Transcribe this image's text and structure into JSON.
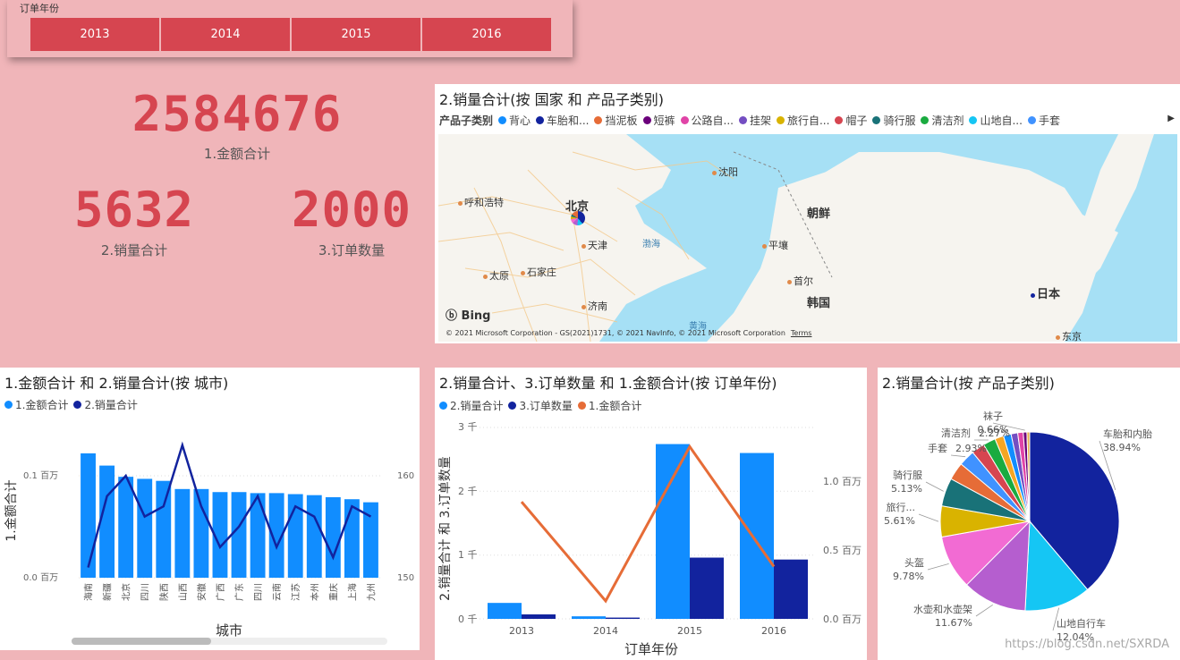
{
  "slicer": {
    "title": "订单年份",
    "years": [
      "2013",
      "2014",
      "2015",
      "2016"
    ]
  },
  "cards": {
    "amount": {
      "value": "2584676",
      "label": "1.金额合计"
    },
    "sales": {
      "value": "5632",
      "label": "2.销量合计"
    },
    "orders": {
      "value": "2000",
      "label": "3.订单数量"
    }
  },
  "map_panel": {
    "title": "2.销量合计(按 国家 和 产品子类别)",
    "legend_title": "产品子类别",
    "legend_items": [
      {
        "label": "背心",
        "color": "#118dff"
      },
      {
        "label": "车胎和...",
        "color": "#12239e"
      },
      {
        "label": "挡泥板",
        "color": "#e66c37"
      },
      {
        "label": "短裤",
        "color": "#6b007b"
      },
      {
        "label": "公路自...",
        "color": "#e044a7"
      },
      {
        "label": "挂架",
        "color": "#744ec2"
      },
      {
        "label": "旅行自...",
        "color": "#d9b300"
      },
      {
        "label": "帽子",
        "color": "#d64550"
      },
      {
        "label": "骑行服",
        "color": "#197278"
      },
      {
        "label": "清洁剂",
        "color": "#1aab40"
      },
      {
        "label": "山地自...",
        "color": "#15c6f4"
      },
      {
        "label": "手套",
        "color": "#4092ff"
      }
    ],
    "cities": [
      "呼和浩特",
      "北京",
      "沈阳",
      "朝鲜",
      "天津",
      "渤海",
      "平壤",
      "太原",
      "石家庄",
      "首尔",
      "韩国",
      "济南",
      "日本",
      "黄海",
      "东京"
    ],
    "bing_label": "Bing",
    "copyright": "© 2021 Microsoft Corporation - GS(2021)1731, © 2021 NavInfo, © 2021 Microsoft Corporation",
    "terms": "Terms"
  },
  "city_panel": {
    "title": "1.金额合计 和 2.销量合计(按 城市)",
    "legend": [
      "1.金额合计",
      "2.销量合计"
    ],
    "ylabel": "1.金额合计",
    "xlabel": "城市",
    "left_ticks": [
      "0.1 百万",
      "0.0 百万"
    ],
    "right_ticks": [
      "160",
      "150"
    ]
  },
  "year_panel": {
    "title": "2.销量合计、3.订单数量 和 1.金额合计(按 订单年份)",
    "legend": [
      "2.销量合计",
      "3.订单数量",
      "1.金额合计"
    ],
    "ylabel": "2.销量合计 和 3.订单数量",
    "xlabel": "订单年份",
    "left_ticks": [
      "3 千",
      "2 千",
      "1 千",
      "0 千"
    ],
    "right_ticks": [
      "1.0 百万",
      "0.5 百万",
      "0.0 百万"
    ]
  },
  "pie_panel": {
    "title": "2.销量合计(按 产品子类别)",
    "watermark": "https://blog.csdn.net/SXRDA"
  },
  "chart_data": [
    {
      "type": "bar",
      "title": "1.金额合计 和 2.销量合计(按 城市)",
      "categories": [
        "海南",
        "新疆",
        "北京",
        "四川",
        "陕西",
        "山西",
        "安徽",
        "广西",
        "广东",
        "四川",
        "云南",
        "江苏",
        "本州",
        "重庆",
        "上海",
        "九州"
      ],
      "series": [
        {
          "name": "1.金额合计",
          "kind": "bar",
          "axis": "left",
          "color": "#118dff",
          "values": [
            0.122,
            0.11,
            0.099,
            0.097,
            0.095,
            0.087,
            0.087,
            0.084,
            0.084,
            0.083,
            0.083,
            0.082,
            0.081,
            0.079,
            0.077,
            0.074
          ]
        },
        {
          "name": "2.销量合计",
          "kind": "line",
          "axis": "right",
          "color": "#12239e",
          "values": [
            151,
            158,
            160,
            156,
            157,
            163,
            157,
            153,
            155,
            158,
            153,
            157,
            156,
            152,
            157,
            156
          ]
        }
      ],
      "xlabel": "城市",
      "ylabel": "1.金额合计",
      "ylim_left": [
        0,
        0.1
      ],
      "ylim_right": [
        150,
        160
      ],
      "legend": "top-left",
      "grid": true
    },
    {
      "type": "bar",
      "title": "2.销量合计、3.订单数量 和 1.金额合计(按 订单年份)",
      "categories": [
        "2013",
        "2014",
        "2015",
        "2016"
      ],
      "series": [
        {
          "name": "2.销量合计",
          "kind": "bar",
          "axis": "left",
          "color": "#118dff",
          "values": [
            250,
            40,
            2740,
            2600
          ]
        },
        {
          "name": "3.订单数量",
          "kind": "bar",
          "axis": "left",
          "color": "#12239e",
          "values": [
            70,
            20,
            960,
            930
          ]
        },
        {
          "name": "1.金额合计",
          "kind": "line",
          "axis": "right",
          "color": "#e66c37",
          "values": [
            0.85,
            0.13,
            1.25,
            0.38
          ]
        }
      ],
      "xlabel": "订单年份",
      "ylabel": "2.销量合计 和 3.订单数量",
      "ylim_left": [
        0,
        3000
      ],
      "ylim_right": [
        0,
        1.0
      ],
      "legend": "top-left",
      "grid": true
    },
    {
      "type": "pie",
      "title": "2.销量合计(按 产品子类别)",
      "slices": [
        {
          "label": "车胎和内胎",
          "pct_label": "38.94%",
          "value": 38.94,
          "color": "#12239e"
        },
        {
          "label": "山地自行车",
          "pct_label": "12.04%",
          "value": 12.04,
          "color": "#15c6f4"
        },
        {
          "label": "水壶和水壶架",
          "pct_label": "11.67%",
          "value": 11.67,
          "color": "#b55ecf"
        },
        {
          "label": "头盔",
          "pct_label": "9.78%",
          "value": 9.78,
          "color": "#f26bd3"
        },
        {
          "label": "旅行...",
          "pct_label": "5.61%",
          "value": 5.61,
          "color": "#d9b300"
        },
        {
          "label": "骑行服",
          "pct_label": "5.13%",
          "value": 5.13,
          "color": "#197278"
        },
        {
          "label": "",
          "pct_label": "",
          "value": 3.2,
          "color": "#e66c37"
        },
        {
          "label": "手套",
          "pct_label": "2.93%",
          "value": 2.93,
          "color": "#4092ff"
        },
        {
          "label": "",
          "pct_label": "",
          "value": 2.4,
          "color": "#d64550"
        },
        {
          "label": "清洁剂",
          "pct_label": "2.27%",
          "value": 2.27,
          "color": "#1aab40"
        },
        {
          "label": "",
          "pct_label": "",
          "value": 1.6,
          "color": "#f5a623"
        },
        {
          "label": "",
          "pct_label": "",
          "value": 1.4,
          "color": "#118dff"
        },
        {
          "label": "",
          "pct_label": "",
          "value": 1.2,
          "color": "#744ec2"
        },
        {
          "label": "",
          "pct_label": "",
          "value": 1.0,
          "color": "#e044a7"
        },
        {
          "label": "袜子",
          "pct_label": "0.66%",
          "value": 0.66,
          "color": "#6b007b"
        },
        {
          "label": "",
          "pct_label": "",
          "value": 0.5,
          "color": "#e8b04b"
        }
      ],
      "legend": "none"
    }
  ]
}
